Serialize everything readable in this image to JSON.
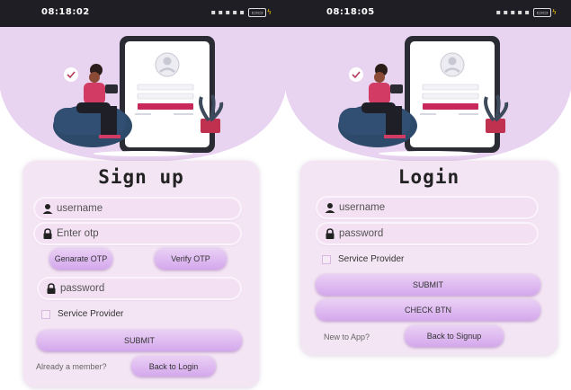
{
  "signup_screen": {
    "status_time": "08:18:02",
    "status_icons": "☐ ⁞ ⁞ ⁞ ⁞",
    "battery": "▭",
    "title": "Sign up",
    "username_placeholder": "username",
    "otp_placeholder": "Enter otp",
    "generate_otp_label": "Genarate OTP",
    "verify_otp_label": "Verify OTP",
    "password_placeholder": "password",
    "service_provider_label": "Service Provider",
    "submit_label": "SUBMIT",
    "already_member_text": "Already a member?",
    "back_to_login_label": "Back to Login"
  },
  "login_screen": {
    "status_time": "08:18:05",
    "title": "Login",
    "username_placeholder": "username",
    "password_placeholder": "password",
    "service_provider_label": "Service Provider",
    "submit_label": "SUBMIT",
    "check_btn_label": "CHECK BTN",
    "new_to_app_text": "New to App?",
    "back_to_signup_label": "Back to Signup"
  },
  "colors": {
    "accent_purple": "#d4a8ec",
    "card_bg": "#f4e5f5",
    "hero_bg": "#e5cfee",
    "status_bar": "#1e1e24"
  },
  "icons": [
    "user-icon",
    "lock-icon",
    "battery-icon",
    "signal-icon"
  ]
}
